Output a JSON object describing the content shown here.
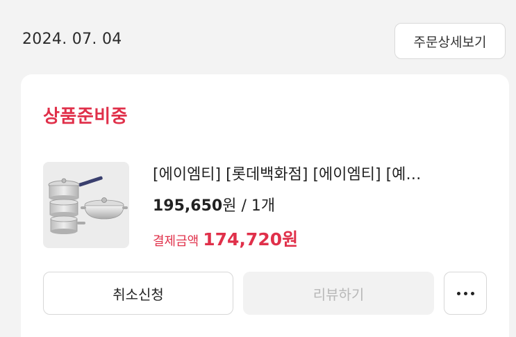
{
  "order": {
    "date": "2024. 07. 04",
    "detail_label": "주문상세보기"
  },
  "card": {
    "status": "상품준비중",
    "product": {
      "name": "[에이엠티] [롯데백화점] [에이엠티] [예…",
      "price": "195,650",
      "currency": "원",
      "quantity": " / 1개",
      "image": "cookware-set-image"
    },
    "payment": {
      "label": "결제금액",
      "amount": "174,720원"
    },
    "actions": {
      "cancel_label": "취소신청",
      "review_label": "리뷰하기",
      "more_icon": "more-horizontal-icon"
    }
  },
  "colors": {
    "status_red": "#e0304a",
    "background": "#f3f3f3",
    "card": "#ffffff"
  }
}
